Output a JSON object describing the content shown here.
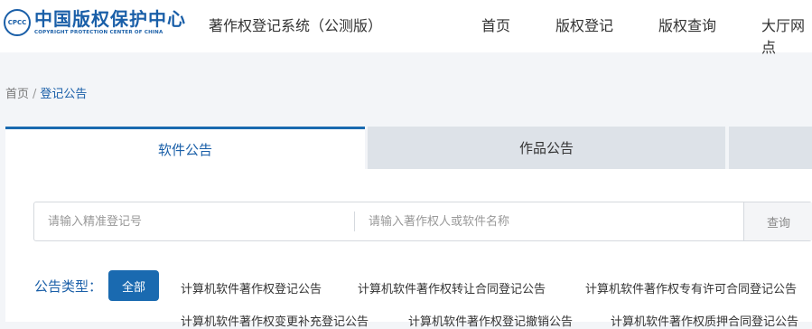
{
  "header": {
    "logo_abbr": "CPCC",
    "logo_cn": "中国版权保护中心",
    "logo_en": "COPYRIGHT PROTECTION CENTER OF CHINA",
    "system_name": "著作权登记系统（公测版）",
    "nav": [
      "首页",
      "版权登记",
      "版权查询",
      "大厅网点"
    ]
  },
  "breadcrumb": {
    "home": "首页",
    "separator": "/",
    "current": "登记公告"
  },
  "tabs": [
    "软件公告",
    "作品公告"
  ],
  "search": {
    "reg_placeholder": "请输入精准登记号",
    "name_placeholder": "请输入著作权人或软件名称",
    "button_label": "查询"
  },
  "types": {
    "label": "公告类型：",
    "selected": "全部",
    "row1": [
      "计算机软件著作权登记公告",
      "计算机软件著作权转让合同登记公告",
      "计算机软件著作权专有许可合同登记公告"
    ],
    "row2": [
      "计算机软件著作权变更补充登记公告",
      "计算机软件著作权登记撤销公告",
      "计算机软件著作权质押合同登记公告"
    ]
  },
  "colors": {
    "brand": "#1a5fa8",
    "accent": "#1a6ab0",
    "page_bg": "#f3f5f8",
    "inactive_tab": "#dde2e8"
  }
}
